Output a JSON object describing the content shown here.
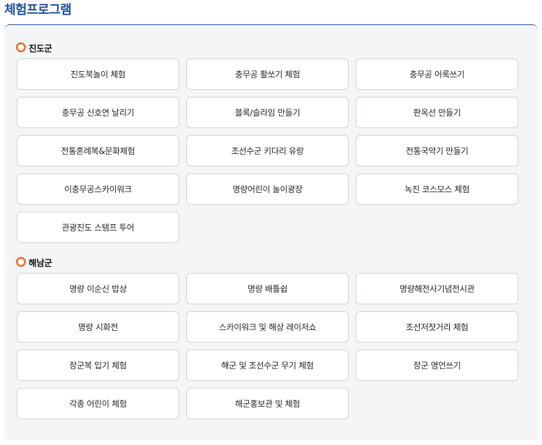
{
  "page": {
    "title": "체험프로그램"
  },
  "colors": {
    "title": "#1f4f96",
    "bullet": "#e8641b",
    "panel_bg": "#f4f5f7",
    "item_border": "#cfd2d6"
  },
  "icons": {
    "section_bullet": "orange-circle-bullet-icon"
  },
  "sections": [
    {
      "label": "진도군",
      "items": [
        "진도북놀이 체험",
        "충무공 활쏘기 체험",
        "충무공 어록쓰기",
        "충무공 신호연 날리기",
        "블록/슬라임 만들기",
        "판옥선 만들기",
        "전통혼례복&문화체험",
        "조선수군 키다리 유랑",
        "전통국악기 만들기",
        "이충무공스카이워크",
        "명량어린이 놀이광장",
        "녹진 코스모스 체험",
        "관광진도 스탬프 투어"
      ]
    },
    {
      "label": "해남군",
      "items": [
        "명량 이순신 밥상",
        "명량 배틀쉽",
        "명량해전사기념전시관",
        "명량 시화전",
        "스카이워크 및 해상 레이저쇼",
        "조선저잣거리 체험",
        "장군복 입기 체험",
        "해군 및 조선수군 무기 체험",
        "장군 명언쓰기",
        "각종 어린이 체험",
        "해군홍보관 및 체험"
      ]
    }
  ]
}
